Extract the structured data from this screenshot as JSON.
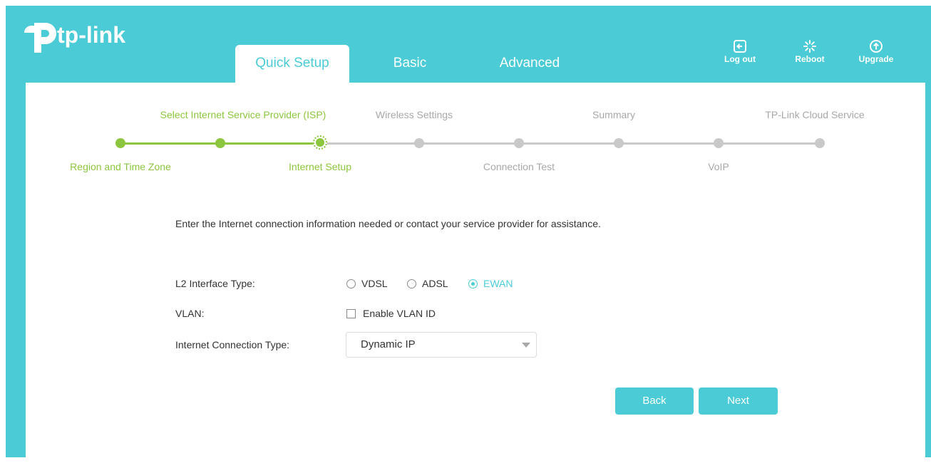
{
  "brand": {
    "name": "tp-link"
  },
  "tabs": [
    {
      "label": "Quick Setup",
      "active": true
    },
    {
      "label": "Basic",
      "active": false
    },
    {
      "label": "Advanced",
      "active": false
    }
  ],
  "header_actions": [
    {
      "label": "Log out",
      "icon": "logout-icon"
    },
    {
      "label": "Reboot",
      "icon": "reboot-icon"
    },
    {
      "label": "Upgrade",
      "icon": "upgrade-icon"
    }
  ],
  "steps": {
    "top": [
      {
        "label": "Select Internet Service Provider (ISP)",
        "status": "done"
      },
      {
        "label": "Wireless Settings",
        "status": "pending"
      },
      {
        "label": "Summary",
        "status": "pending"
      },
      {
        "label": "TP-Link Cloud Service",
        "status": "pending"
      }
    ],
    "bottom": [
      {
        "label": "Region and Time Zone",
        "status": "done"
      },
      {
        "label": "Internet Setup",
        "status": "current"
      },
      {
        "label": "Connection Test",
        "status": "pending"
      },
      {
        "label": "VoIP",
        "status": "pending"
      }
    ]
  },
  "form": {
    "description": "Enter the Internet connection information needed or contact your service provider for assistance.",
    "l2_label": "L2 Interface Type:",
    "l2_options": [
      {
        "label": "VDSL",
        "selected": false
      },
      {
        "label": "ADSL",
        "selected": false
      },
      {
        "label": "EWAN",
        "selected": true
      }
    ],
    "vlan_label": "VLAN:",
    "vlan_checkbox": {
      "label": "Enable VLAN ID",
      "checked": false
    },
    "connection_label": "Internet Connection Type:",
    "connection_value": "Dynamic IP"
  },
  "buttons": {
    "back": "Back",
    "next": "Next"
  },
  "colors": {
    "accent": "#4acbd6",
    "progress_done": "#8cc63f",
    "progress_pending": "#c9c9c9"
  }
}
